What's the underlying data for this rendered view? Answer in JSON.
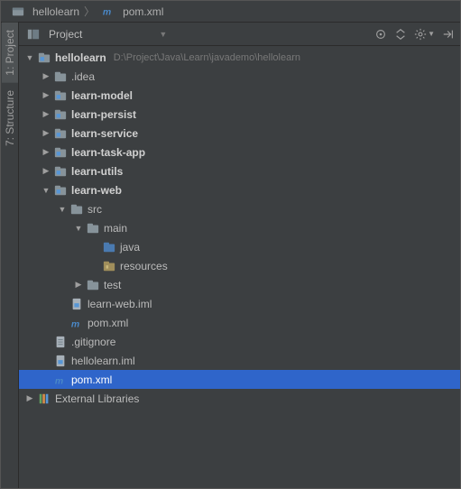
{
  "breadcrumb": {
    "root": "hellolearn",
    "file": "pom.xml"
  },
  "panel": {
    "title": "Project"
  },
  "sidebar": {
    "tabs": [
      {
        "label": "1: Project",
        "active": true
      },
      {
        "label": "7: Structure",
        "active": false
      }
    ]
  },
  "tree": {
    "root": {
      "name": "hellolearn",
      "path": "D:\\Project\\Java\\Learn\\javademo\\hellolearn"
    },
    "nodes": [
      {
        "indent": 0,
        "arrow": "down",
        "icon": "module",
        "label": "hellolearn",
        "bold": true,
        "hint": "D:\\Project\\Java\\Learn\\javademo\\hellolearn"
      },
      {
        "indent": 1,
        "arrow": "right",
        "icon": "folder",
        "label": ".idea"
      },
      {
        "indent": 1,
        "arrow": "right",
        "icon": "module",
        "label": "learn-model",
        "bold": true
      },
      {
        "indent": 1,
        "arrow": "right",
        "icon": "module",
        "label": "learn-persist",
        "bold": true
      },
      {
        "indent": 1,
        "arrow": "right",
        "icon": "module",
        "label": "learn-service",
        "bold": true
      },
      {
        "indent": 1,
        "arrow": "right",
        "icon": "module",
        "label": "learn-task-app",
        "bold": true
      },
      {
        "indent": 1,
        "arrow": "right",
        "icon": "module",
        "label": "learn-utils",
        "bold": true
      },
      {
        "indent": 1,
        "arrow": "down",
        "icon": "module",
        "label": "learn-web",
        "bold": true
      },
      {
        "indent": 2,
        "arrow": "down",
        "icon": "folder",
        "label": "src"
      },
      {
        "indent": 3,
        "arrow": "down",
        "icon": "folder",
        "label": "main"
      },
      {
        "indent": 4,
        "arrow": "none",
        "icon": "source",
        "label": "java"
      },
      {
        "indent": 4,
        "arrow": "none",
        "icon": "resource",
        "label": "resources"
      },
      {
        "indent": 3,
        "arrow": "right",
        "icon": "folder",
        "label": "test"
      },
      {
        "indent": 2,
        "arrow": "none",
        "icon": "iml",
        "label": "learn-web.iml"
      },
      {
        "indent": 2,
        "arrow": "none",
        "icon": "maven",
        "label": "pom.xml"
      },
      {
        "indent": 1,
        "arrow": "none",
        "icon": "file",
        "label": ".gitignore"
      },
      {
        "indent": 1,
        "arrow": "none",
        "icon": "iml",
        "label": "hellolearn.iml"
      },
      {
        "indent": 1,
        "arrow": "none",
        "icon": "maven",
        "label": "pom.xml",
        "selected": true
      },
      {
        "indent": 0,
        "arrow": "right",
        "icon": "lib",
        "label": "External Libraries"
      }
    ]
  }
}
